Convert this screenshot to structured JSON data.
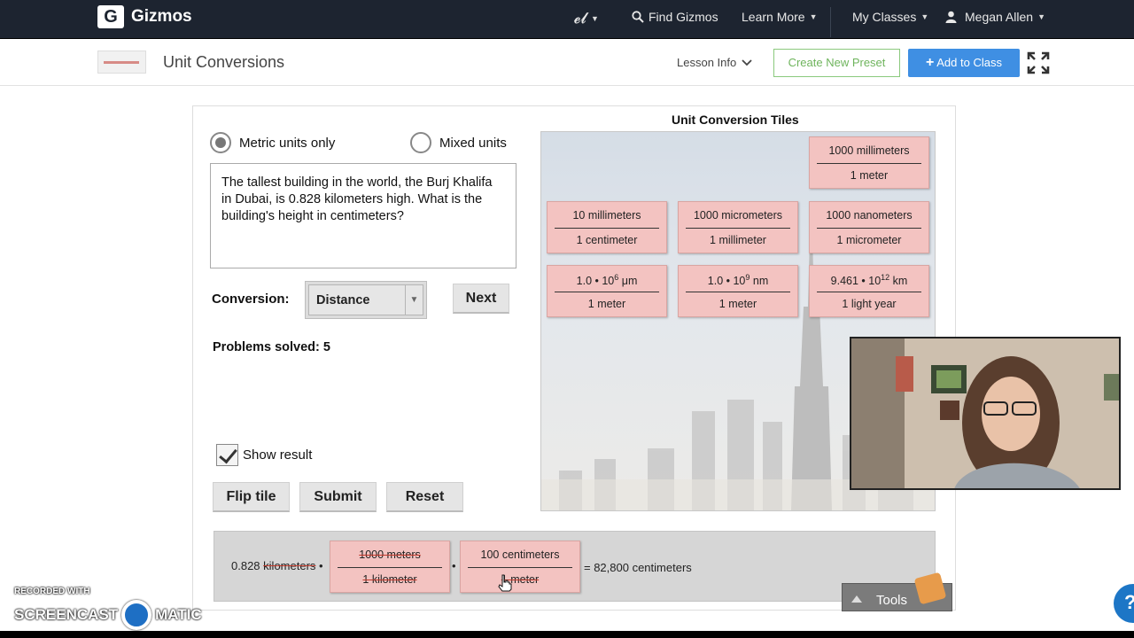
{
  "nav": {
    "logo_letter": "G",
    "logo_text": "Gizmos",
    "el_menu": "𝓮𝓵",
    "find": "Find Gizmos",
    "learn_more": "Learn More",
    "my_classes": "My Classes",
    "user": "Megan Allen"
  },
  "header": {
    "title": "Unit Conversions",
    "lesson_info": "Lesson Info",
    "create_preset": "Create New Preset",
    "add_to_class": "Add to Class"
  },
  "gizmo": {
    "radio_metric": "Metric units only",
    "radio_mixed": "Mixed units",
    "metric_selected": true,
    "question": "The tallest building in the world, the Burj Khalifa in Dubai, is 0.828 kilometers high. What is the building's height in centimeters?",
    "conversion_label": "Conversion:",
    "conversion_value": "Distance",
    "next": "Next",
    "problems_solved": "Problems solved: 5",
    "show_result": "Show result",
    "show_result_checked": true,
    "flip_tile": "Flip tile",
    "submit": "Submit",
    "reset": "Reset",
    "tiles_title": "Unit Conversion Tiles",
    "tiles": [
      {
        "num": "1000 millimeters",
        "den": "1 meter"
      },
      {
        "num": "10 millimeters",
        "den": "1 centimeter"
      },
      {
        "num": "1000 micrometers",
        "den": "1 millimeter"
      },
      {
        "num": "1000 nanometers",
        "den": "1 micrometer"
      },
      {
        "num_base": "1.0 • 10",
        "num_exp": "6",
        "num_unit": " μm",
        "den": "1 meter"
      },
      {
        "num_base": "1.0 • 10",
        "num_exp": "9",
        "num_unit": " nm",
        "den": "1 meter"
      },
      {
        "num_base": "9.461 • 10",
        "num_exp": "12",
        "num_unit": " km",
        "den": "1 light year"
      }
    ],
    "result": {
      "start_value": "0.828",
      "start_unit": "kilometers",
      "dot": "•",
      "tile1_num": "1000 meters",
      "tile1_den": "1 kilometer",
      "tile2_num": "100 centimeters",
      "tile2_den": "1 meter",
      "answer": "= 82,800 centimeters"
    },
    "tools": "Tools"
  },
  "overlay": {
    "recorded_with": "RECORDED WITH",
    "screencast": "SCREENCAST",
    "matic": "MATIC",
    "help": "?"
  },
  "colors": {
    "nav_bg": "#1d2430",
    "add_button": "#3f8fe3",
    "preset_border": "#8bc97d",
    "tile_fill": "#f3c3c1",
    "strike": "#c0392b"
  }
}
